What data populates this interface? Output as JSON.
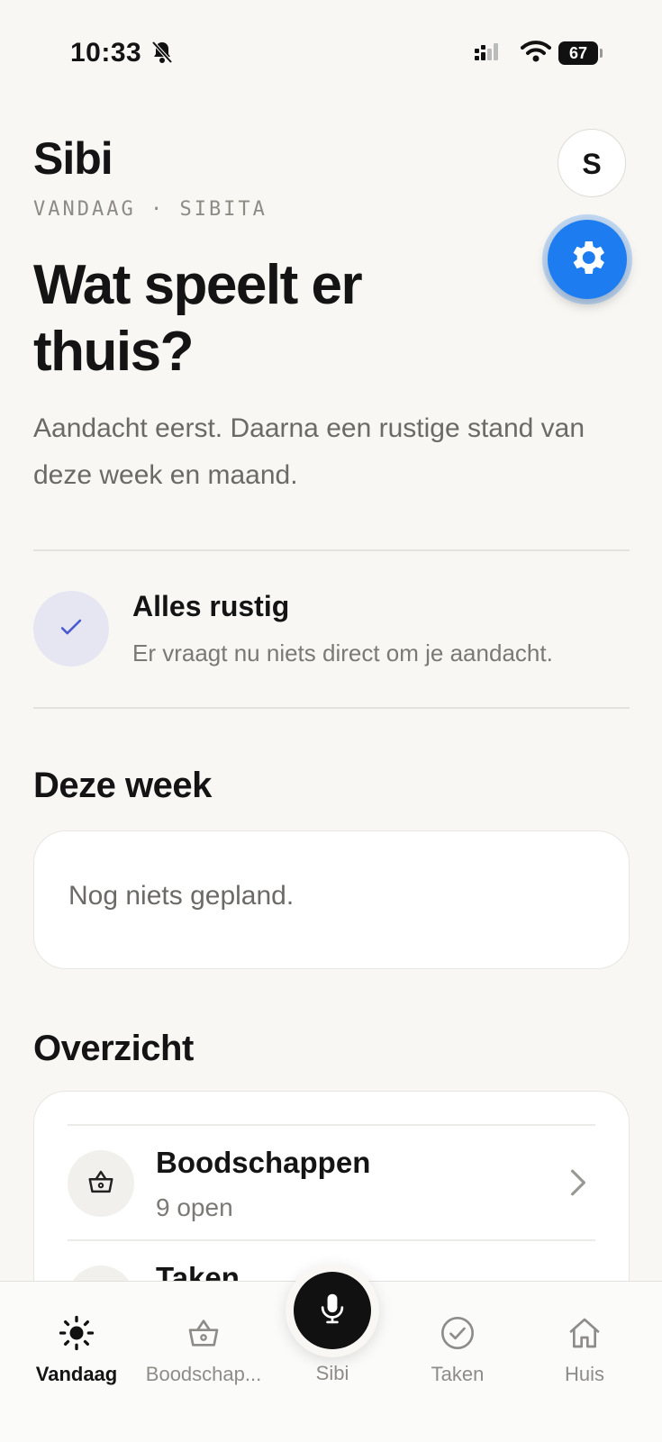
{
  "status_bar": {
    "time": "10:33",
    "battery": "67"
  },
  "header": {
    "app_name": "Sibi",
    "eyebrow": "VANDAAG · SIBITA",
    "avatar_initial": "S",
    "headline": "Wat speelt er thuis?",
    "subtext": "Aandacht eerst. Daarna een rustige stand van deze week en maand."
  },
  "attention": {
    "title": "Alles rustig",
    "subtitle": "Er vraagt nu niets direct om je aandacht."
  },
  "week": {
    "title": "Deze week",
    "empty_text": "Nog niets gepland."
  },
  "overview": {
    "title": "Overzicht",
    "items": [
      {
        "title": "Boodschappen",
        "subtitle": "9 open",
        "icon": "basket-icon"
      },
      {
        "title": "Taken",
        "icon": "check-icon"
      }
    ]
  },
  "tabbar": {
    "tabs": [
      {
        "label": "Vandaag",
        "icon": "sun-icon",
        "active": true
      },
      {
        "label": "Boodschap...",
        "icon": "basket-icon"
      },
      {
        "label": "Sibi",
        "icon": "mic-icon"
      },
      {
        "label": "Taken",
        "icon": "check-circle-icon"
      },
      {
        "label": "Huis",
        "icon": "house-icon"
      }
    ]
  },
  "colors": {
    "accent": "#1d7df0",
    "background": "#f8f7f4",
    "check_bg": "#e6e6f3",
    "check_stroke": "#4a5bd0"
  }
}
